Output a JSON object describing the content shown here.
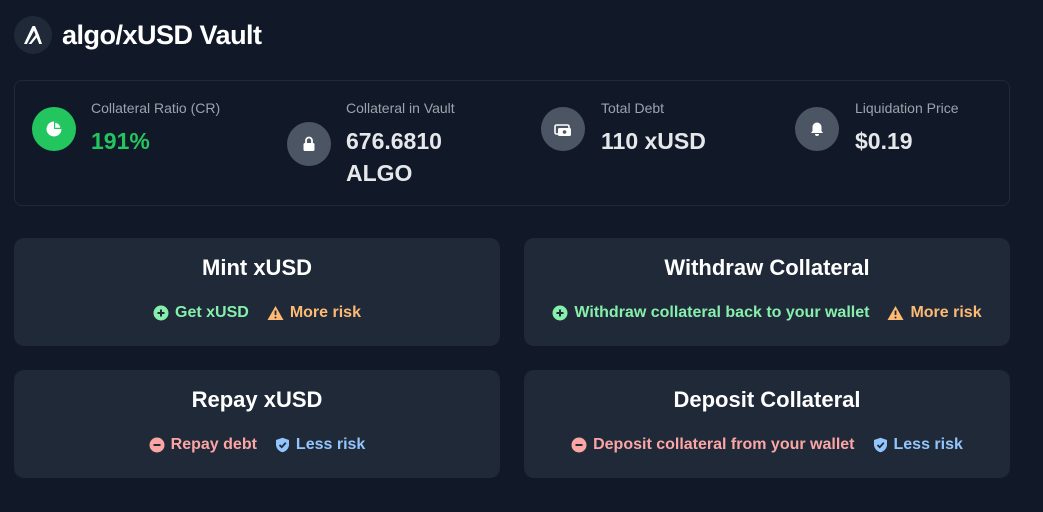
{
  "header": {
    "title": "algo/xUSD Vault",
    "logo_icon": "algorand-logo-icon"
  },
  "stats": [
    {
      "label": "Collateral Ratio (CR)",
      "value": "191%",
      "icon": "pie-chart-icon",
      "color": "#22c55e"
    },
    {
      "label": "Collateral in Vault",
      "value_line1": "676.6810",
      "value_line2": "ALGO",
      "icon": "lock-icon"
    },
    {
      "label": "Total Debt",
      "value": "110 xUSD",
      "icon": "cash-icon"
    },
    {
      "label": "Liquidation Price",
      "value": "$0.19",
      "icon": "bell-icon"
    }
  ],
  "actions": {
    "mint": {
      "title": "Mint xUSD",
      "badges": [
        {
          "text": "Get xUSD",
          "icon": "plus-circle-icon",
          "color": "#86efac"
        },
        {
          "text": "More risk",
          "icon": "warning-icon",
          "color": "#fdba74"
        }
      ]
    },
    "withdraw": {
      "title": "Withdraw Collateral",
      "badges": [
        {
          "text": "Withdraw collateral back to your wallet",
          "icon": "plus-circle-icon",
          "color": "#86efac"
        },
        {
          "text": "More risk",
          "icon": "warning-icon",
          "color": "#fdba74"
        }
      ]
    },
    "repay": {
      "title": "Repay xUSD",
      "badges": [
        {
          "text": "Repay debt",
          "icon": "minus-circle-icon",
          "color": "#fca5a5"
        },
        {
          "text": "Less risk",
          "icon": "shield-check-icon",
          "color": "#93c5fd"
        }
      ]
    },
    "deposit": {
      "title": "Deposit Collateral",
      "badges": [
        {
          "text": "Deposit collateral from your wallet",
          "icon": "minus-circle-icon",
          "color": "#fca5a5"
        },
        {
          "text": "Less risk",
          "icon": "shield-check-icon",
          "color": "#93c5fd"
        }
      ]
    }
  }
}
